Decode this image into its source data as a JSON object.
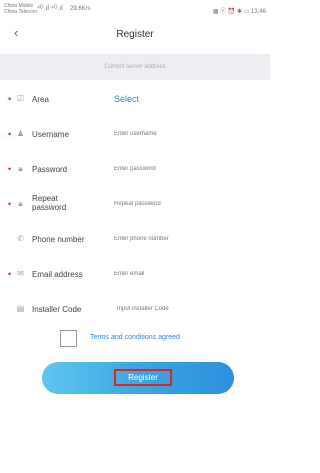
{
  "status_bar": {
    "carrier_line1": "China Mobile",
    "carrier_line2": "China Telecom",
    "signal": "⁴ᴳ.ıl ⁴ᴳ.ıl",
    "speed": "29.6K/s",
    "right": "▦ ⓝ ⏰ ✱ ▭ 13:46"
  },
  "nav": {
    "back_icon": "chevron-left",
    "title": "Register"
  },
  "server_bar": {
    "text": "Current server address"
  },
  "fields": [
    {
      "key": "area",
      "icon": "area-icon",
      "required": true,
      "label": "Area",
      "select_text": "Select"
    },
    {
      "key": "username",
      "icon": "user-icon",
      "required": true,
      "label": "Username",
      "placeholder": "Enter username"
    },
    {
      "key": "password",
      "icon": "lock-icon",
      "required": true,
      "label": "Password",
      "placeholder": "Enter password"
    },
    {
      "key": "repeat_password",
      "icon": "lock-icon",
      "required": true,
      "label": "Repeat password",
      "placeholder": "Repeat password"
    },
    {
      "key": "phone",
      "icon": "phone-icon",
      "required": false,
      "label": "Phone number",
      "placeholder": "Enter phone number"
    },
    {
      "key": "email",
      "icon": "mail-icon",
      "required": true,
      "label": "Email address",
      "placeholder": "Enter email"
    },
    {
      "key": "installer_code",
      "icon": "id-icon",
      "required": false,
      "label": "Installer Code",
      "placeholder": "Input installer Code"
    }
  ],
  "terms": {
    "text": "Terms and conditions agreed",
    "checked": false
  },
  "register_button": {
    "label": "Register"
  },
  "colors": {
    "accent": "#2e86de",
    "required": "#e02020",
    "highlight": "#e2231a"
  }
}
